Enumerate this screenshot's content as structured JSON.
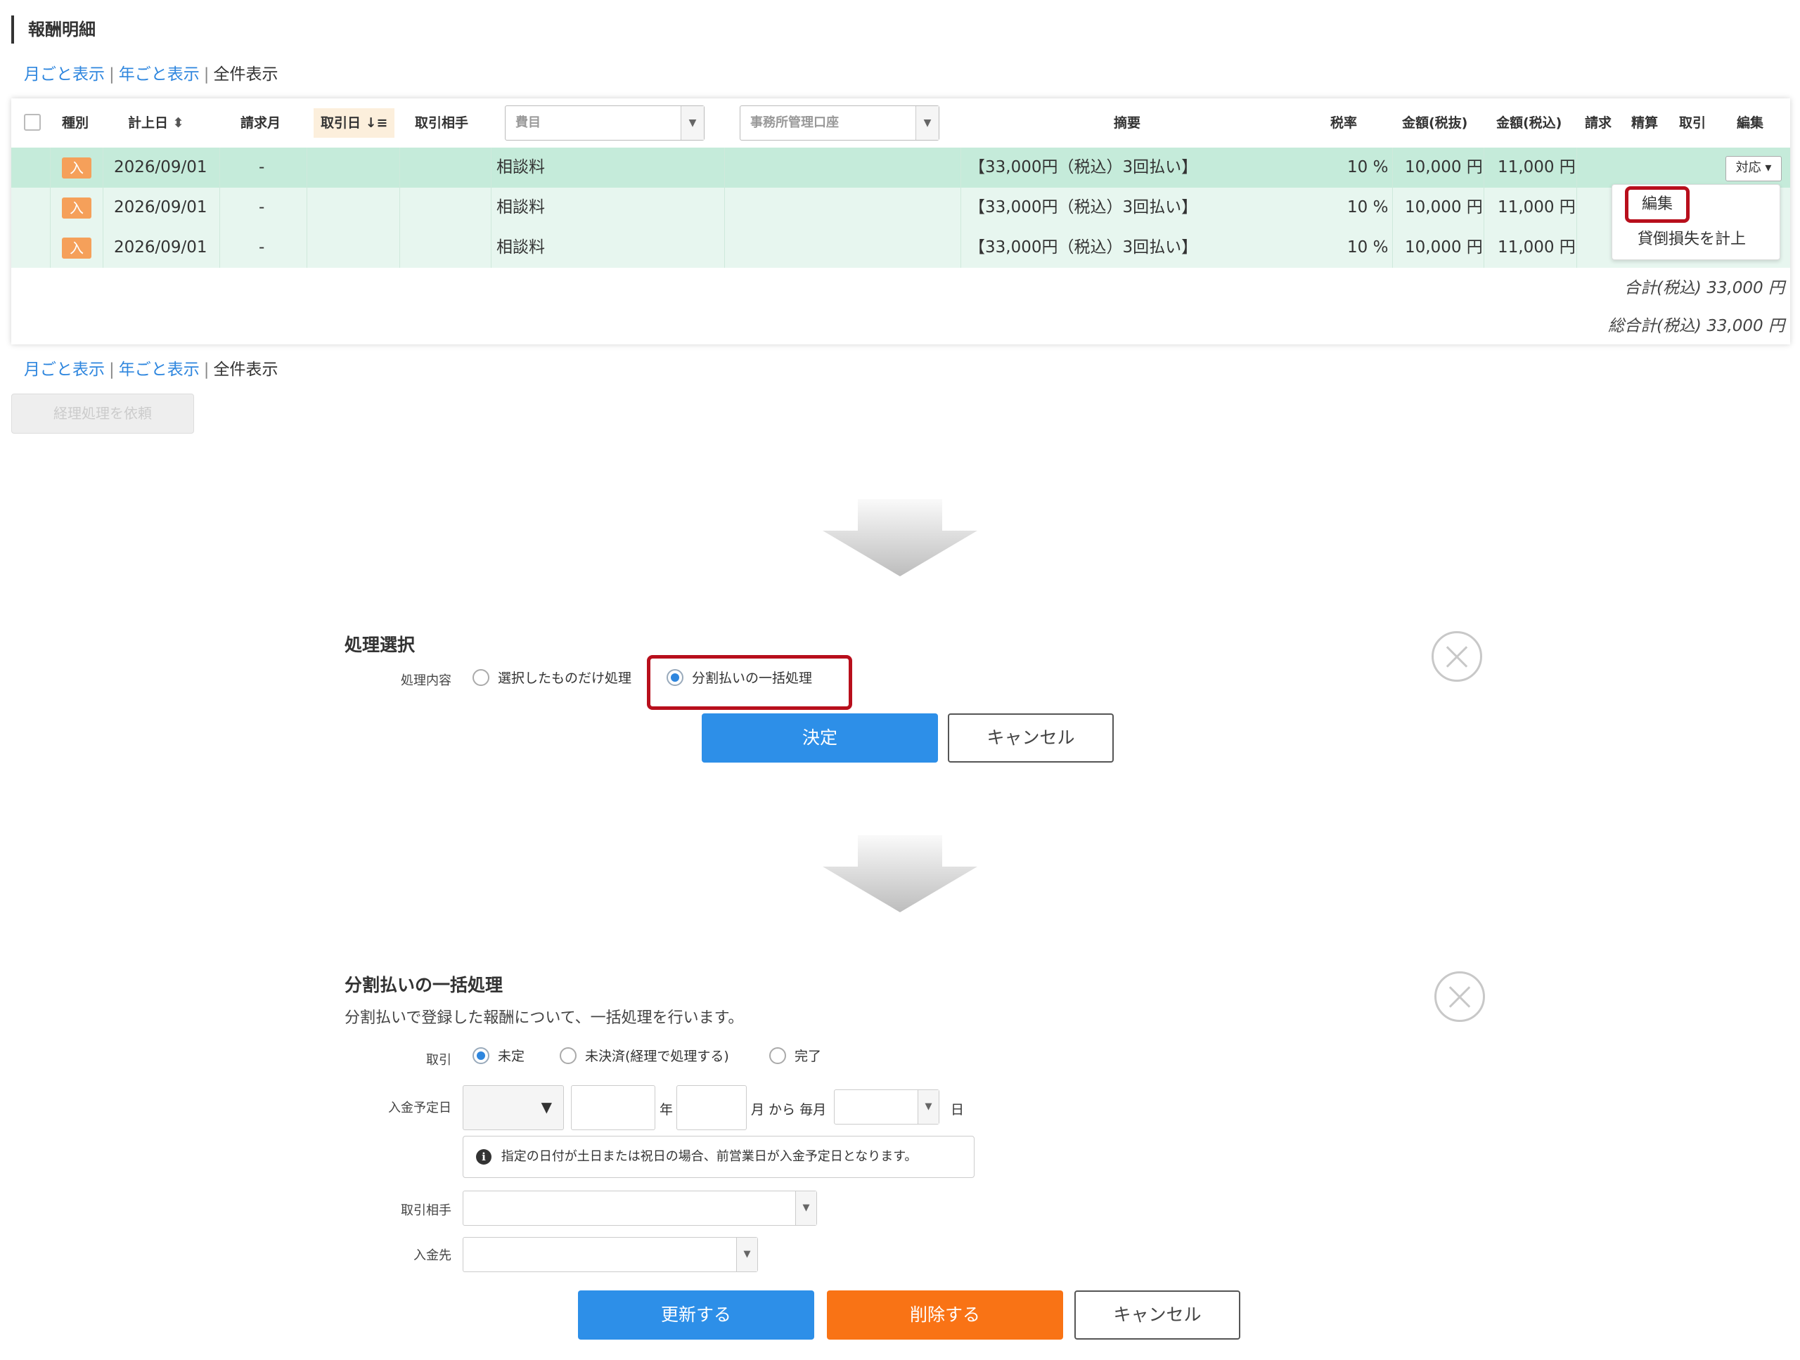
{
  "page_title": "報酬明細",
  "view_links": {
    "monthly": "月ごと表示",
    "yearly": "年ごと表示",
    "all": "全件表示",
    "sep": "|"
  },
  "table": {
    "headers": {
      "type": "種別",
      "date": "計上日",
      "sort_icon": "⬍",
      "billing_month": "請求月",
      "trade_date": "取引日",
      "trade_sort_icon": "↓≡",
      "partner": "取引相手",
      "summary": "摘要",
      "tax_rate": "税率",
      "amount_ex": "金額(税抜)",
      "amount_in": "金額(税込)",
      "bill": "請求",
      "settle": "精算",
      "trade": "取引",
      "edit": "編集"
    },
    "filters": {
      "expense_placeholder": "費目",
      "account_placeholder": "事務所管理口座"
    },
    "rows": [
      {
        "badge": "入",
        "date": "2026/09/01",
        "billing_month": "-",
        "item": "相談料",
        "summary": "【33,000円（税込）3回払い】",
        "tax_rate": "10 %",
        "amount_ex": "10,000 円",
        "amount_in": "11,000 円",
        "action": "対応"
      },
      {
        "badge": "入",
        "date": "2026/09/01",
        "billing_month": "-",
        "item": "相談料",
        "summary": "【33,000円（税込）3回払い】",
        "tax_rate": "10 %",
        "amount_ex": "10,000 円",
        "amount_in": "11,000 円"
      },
      {
        "badge": "入",
        "date": "2026/09/01",
        "billing_month": "-",
        "item": "相談料",
        "summary": "【33,000円（税込）3回払い】",
        "tax_rate": "10 %",
        "amount_ex": "10,000 円",
        "amount_in": "11,000 円"
      }
    ],
    "subtotal": "合計(税込) 33,000 円",
    "grand_total": "総合計(税込) 33,000 円",
    "dropdown": {
      "edit": "編集",
      "bad_debt": "貸倒損失を計上"
    }
  },
  "request_button": "経理処理を依頼",
  "process_select": {
    "title": "処理選択",
    "content_label": "処理内容",
    "option_selected_only": "選択したものだけ処理",
    "option_batch": "分割払いの一括処理",
    "confirm": "決定",
    "cancel": "キャンセル"
  },
  "batch": {
    "title": "分割払いの一括処理",
    "description": "分割払いで登録した報酬について、一括処理を行います。",
    "trade_label": "取引",
    "trade_options": [
      "未定",
      "未決済(経理で処理する)",
      "完了"
    ],
    "deposit_date_label": "入金予定日",
    "year_suffix": "年",
    "month_from": "月 から 毎月",
    "day_suffix": "日",
    "info_icon": "i",
    "info_text": "指定の日付が土日または祝日の場合、前営業日が入金予定日となります。",
    "partner_label": "取引相手",
    "deposit_to_label": "入金先",
    "update": "更新する",
    "delete": "削除する",
    "cancel": "キャンセル"
  }
}
